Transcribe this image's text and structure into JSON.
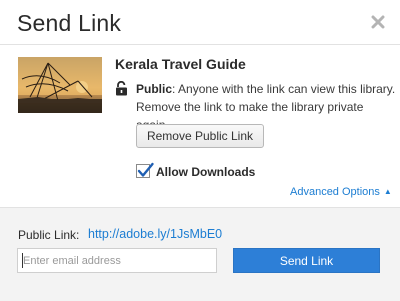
{
  "dialog": {
    "title": "Send Link",
    "close_icon": "close-icon"
  },
  "library": {
    "name": "Kerala Travel Guide",
    "thumbnail_icon": "library-thumbnail-image"
  },
  "sharing": {
    "lock_icon": "unlocked-padlock-icon",
    "status_label": "Public",
    "description_line1": ": Anyone with the link can view this library.",
    "description_line2": "Remove the link to make the library private again.",
    "remove_button_label": "Remove Public Link",
    "allow_downloads_label": "Allow Downloads",
    "allow_downloads_checked": true,
    "advanced_options_label": "Advanced Options",
    "advanced_caret_icon": "caret-up-icon"
  },
  "footer": {
    "public_link_label": "Public Link:",
    "public_link_url": "http://adobe.ly/1JsMbE0",
    "email_placeholder": "Enter email address",
    "send_button_label": "Send Link"
  },
  "colors": {
    "accent": "#2d7fd7",
    "link": "#1c7dd2",
    "footer_bg": "#f3f3f3"
  }
}
